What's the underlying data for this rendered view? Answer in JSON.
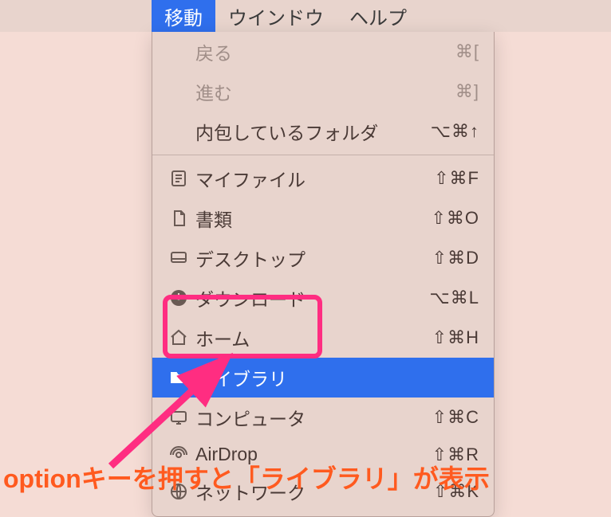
{
  "menubar": {
    "items": [
      {
        "label": "移動",
        "active": true
      },
      {
        "label": "ウインドウ",
        "active": false
      },
      {
        "label": "ヘルプ",
        "active": false
      }
    ]
  },
  "dropdown": {
    "nav": [
      {
        "label": "戻る",
        "shortcut": "⌘[",
        "disabled": true
      },
      {
        "label": "進む",
        "shortcut": "⌘]",
        "disabled": true
      },
      {
        "label": "内包しているフォルダ",
        "shortcut": "⌥⌘↑",
        "disabled": false
      }
    ],
    "places": [
      {
        "label": "マイファイル",
        "shortcut": "⇧⌘F",
        "icon": "myfiles"
      },
      {
        "label": "書類",
        "shortcut": "⇧⌘O",
        "icon": "documents"
      },
      {
        "label": "デスクトップ",
        "shortcut": "⇧⌘D",
        "icon": "desktop"
      },
      {
        "label": "ダウンロード",
        "shortcut": "⌥⌘L",
        "icon": "downloads"
      },
      {
        "label": "ホーム",
        "shortcut": "⇧⌘H",
        "icon": "home"
      },
      {
        "label": "ライブラリ",
        "shortcut": "",
        "icon": "library",
        "highlighted": true
      },
      {
        "label": "コンピュータ",
        "shortcut": "⇧⌘C",
        "icon": "computer"
      },
      {
        "label": "AirDrop",
        "shortcut": "⇧⌘R",
        "icon": "airdrop"
      },
      {
        "label": "ネットワーク",
        "shortcut": "⇧⌘K",
        "icon": "network"
      }
    ]
  },
  "annotation": {
    "text": "optionキーを押すと「ライブラリ」が表示"
  }
}
